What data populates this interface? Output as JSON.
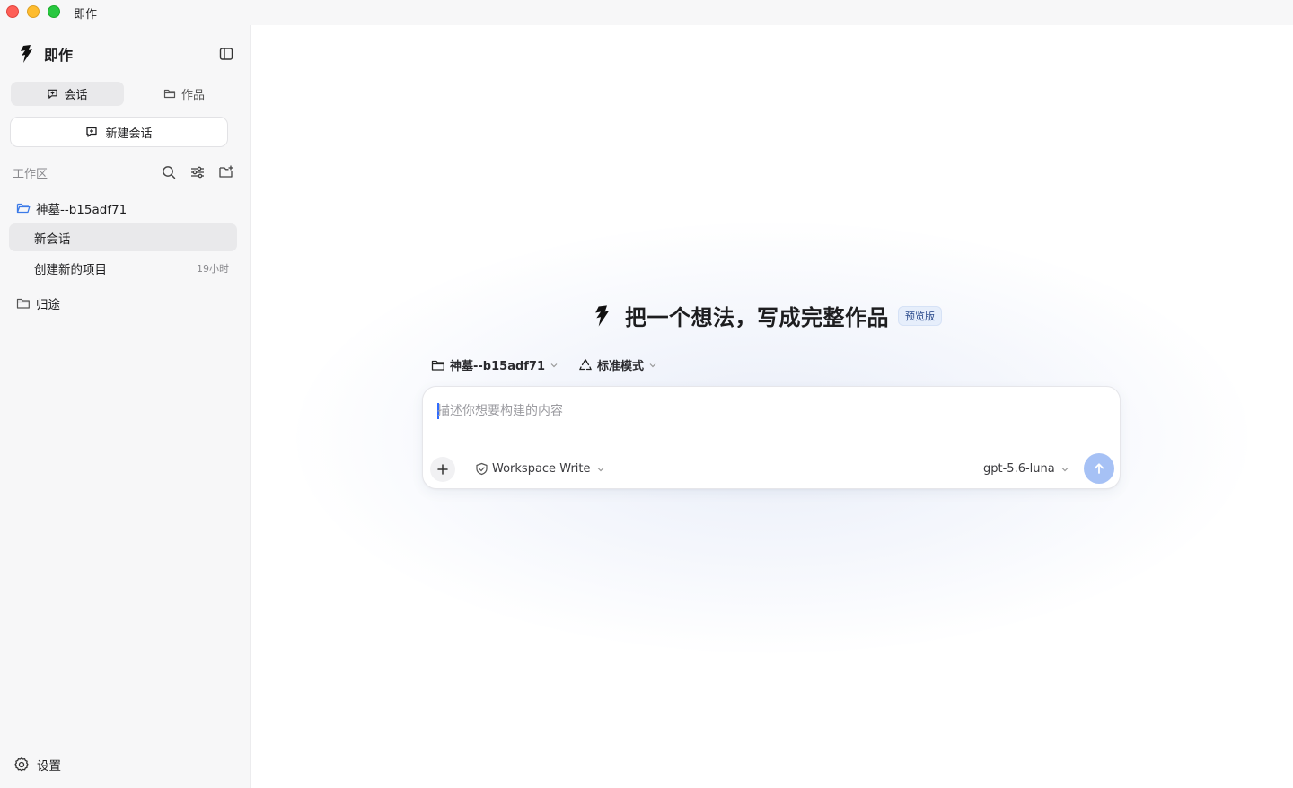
{
  "window": {
    "title": "即作"
  },
  "sidebar": {
    "brand": "即作",
    "tabs": [
      {
        "label": "会话",
        "icon": "chat-icon",
        "active": true
      },
      {
        "label": "作品",
        "icon": "folder-icon",
        "active": false
      }
    ],
    "new_chat_label": "新建会话",
    "workspace_label": "工作区",
    "tree": [
      {
        "name": "神墓--b15adf71",
        "icon": "folder-open-icon",
        "items": [
          {
            "title": "新会话",
            "time": "",
            "active": true
          },
          {
            "title": "创建新的项目",
            "time": "19小时",
            "active": false
          }
        ]
      },
      {
        "name": "归途",
        "icon": "folder-icon",
        "items": []
      }
    ],
    "settings_label": "设置"
  },
  "main": {
    "hero_title": "把一个想法，写成完整作品",
    "badge": "预览版",
    "project_selector": "神墓--b15adf71",
    "mode_selector": "标准模式",
    "prompt": {
      "placeholder": "描述你想要构建的内容",
      "value": ""
    },
    "permission": "Workspace Write",
    "model": "gpt-5.6-luna"
  },
  "colors": {
    "accent": "#2f6bff",
    "send_button": "#a6c1f5",
    "sidebar_bg": "#f7f7f8",
    "badge_bg": "#e6eefb",
    "badge_text": "#2a4a8c",
    "folder_blue": "#3b7ae8"
  }
}
